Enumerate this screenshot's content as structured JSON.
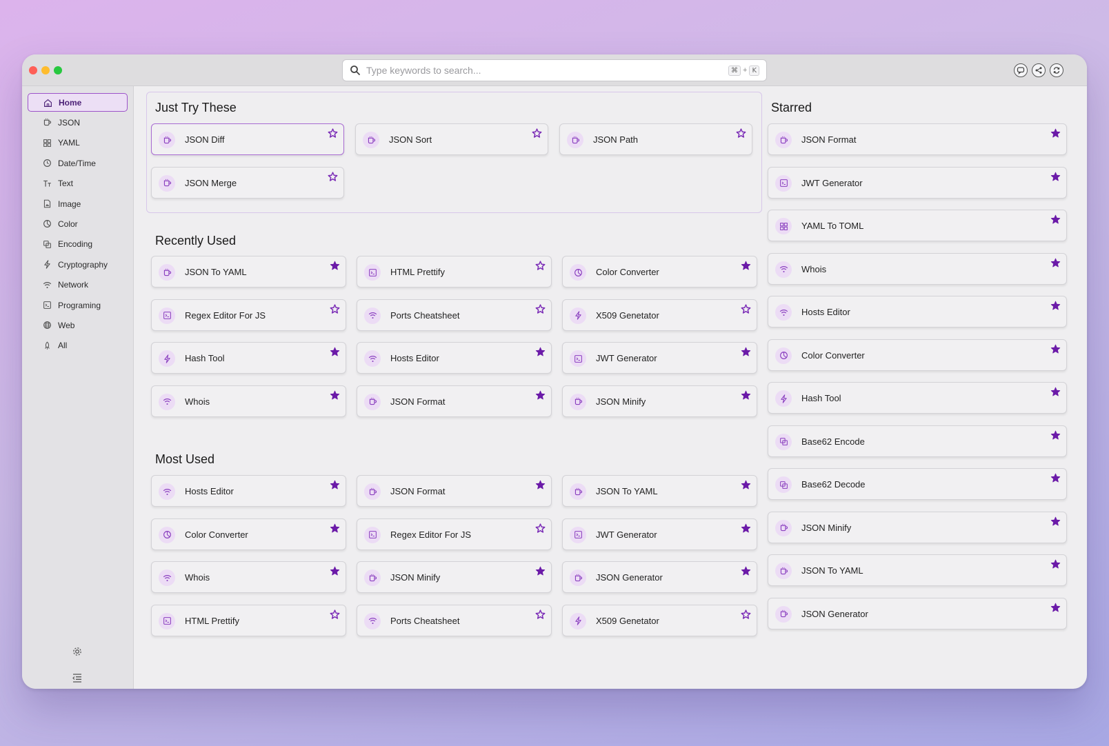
{
  "search": {
    "placeholder": "Type keywords to search...",
    "shortcut_cmd": "⌘",
    "shortcut_plus": "+",
    "shortcut_key": "K"
  },
  "sidebar": {
    "items": [
      {
        "label": "Home",
        "icon": "home-icon",
        "active": true
      },
      {
        "label": "JSON",
        "icon": "mug-icon"
      },
      {
        "label": "YAML",
        "icon": "grid-icon"
      },
      {
        "label": "Date/Time",
        "icon": "clock-icon"
      },
      {
        "label": "Text",
        "icon": "text-icon"
      },
      {
        "label": "Image",
        "icon": "image-icon"
      },
      {
        "label": "Color",
        "icon": "palette-icon"
      },
      {
        "label": "Encoding",
        "icon": "encoding-icon"
      },
      {
        "label": "Cryptography",
        "icon": "bolt-icon"
      },
      {
        "label": "Network",
        "icon": "wifi-icon"
      },
      {
        "label": "Programing",
        "icon": "terminal-icon"
      },
      {
        "label": "Web",
        "icon": "globe-icon"
      },
      {
        "label": "All",
        "icon": "rocket-icon"
      }
    ]
  },
  "sections": {
    "just_try": {
      "title": "Just Try These",
      "cards": [
        {
          "label": "JSON Diff",
          "icon": "mug-icon",
          "starred": false,
          "highlight": true
        },
        {
          "label": "JSON Sort",
          "icon": "mug-icon",
          "starred": false
        },
        {
          "label": "JSON Path",
          "icon": "mug-icon",
          "starred": false
        },
        {
          "label": "JSON Merge",
          "icon": "mug-icon",
          "starred": false
        }
      ]
    },
    "recently_used": {
      "title": "Recently Used",
      "cards": [
        {
          "label": "JSON To YAML",
          "icon": "mug-icon",
          "starred": true
        },
        {
          "label": "HTML Prettify",
          "icon": "terminal-icon",
          "starred": false
        },
        {
          "label": "Color Converter",
          "icon": "palette-icon",
          "starred": true
        },
        {
          "label": "Regex Editor For JS",
          "icon": "terminal-icon",
          "starred": false
        },
        {
          "label": "Ports Cheatsheet",
          "icon": "wifi-icon",
          "starred": false
        },
        {
          "label": "X509 Genetator",
          "icon": "bolt-icon",
          "starred": false
        },
        {
          "label": "Hash Tool",
          "icon": "bolt-icon",
          "starred": true
        },
        {
          "label": "Hosts Editor",
          "icon": "wifi-icon",
          "starred": true
        },
        {
          "label": "JWT Generator",
          "icon": "terminal-icon",
          "starred": true
        },
        {
          "label": "Whois",
          "icon": "wifi-icon",
          "starred": true
        },
        {
          "label": "JSON Format",
          "icon": "mug-icon",
          "starred": true
        },
        {
          "label": "JSON Minify",
          "icon": "mug-icon",
          "starred": true
        }
      ]
    },
    "most_used": {
      "title": "Most Used",
      "cards": [
        {
          "label": "Hosts Editor",
          "icon": "wifi-icon",
          "starred": true
        },
        {
          "label": "JSON Format",
          "icon": "mug-icon",
          "starred": true
        },
        {
          "label": "JSON To YAML",
          "icon": "mug-icon",
          "starred": true
        },
        {
          "label": "Color Converter",
          "icon": "palette-icon",
          "starred": true
        },
        {
          "label": "Regex Editor For JS",
          "icon": "terminal-icon",
          "starred": false
        },
        {
          "label": "JWT Generator",
          "icon": "terminal-icon",
          "starred": true
        },
        {
          "label": "Whois",
          "icon": "wifi-icon",
          "starred": true
        },
        {
          "label": "JSON Minify",
          "icon": "mug-icon",
          "starred": true
        },
        {
          "label": "JSON Generator",
          "icon": "mug-icon",
          "starred": true
        },
        {
          "label": "HTML Prettify",
          "icon": "terminal-icon",
          "starred": false
        },
        {
          "label": "Ports Cheatsheet",
          "icon": "wifi-icon",
          "starred": false
        },
        {
          "label": "X509 Genetator",
          "icon": "bolt-icon",
          "starred": false
        }
      ]
    },
    "starred": {
      "title": "Starred",
      "cards": [
        {
          "label": "JSON Format",
          "icon": "mug-icon",
          "starred": true
        },
        {
          "label": "JWT Generator",
          "icon": "terminal-icon",
          "starred": true
        },
        {
          "label": "YAML To TOML",
          "icon": "grid-icon",
          "starred": true
        },
        {
          "label": "Whois",
          "icon": "wifi-icon",
          "starred": true
        },
        {
          "label": "Hosts Editor",
          "icon": "wifi-icon",
          "starred": true
        },
        {
          "label": "Color Converter",
          "icon": "palette-icon",
          "starred": true
        },
        {
          "label": "Hash Tool",
          "icon": "bolt-icon",
          "starred": true
        },
        {
          "label": "Base62 Encode",
          "icon": "encoding-icon",
          "starred": true
        },
        {
          "label": "Base62 Decode",
          "icon": "encoding-icon",
          "starred": true
        },
        {
          "label": "JSON Minify",
          "icon": "mug-icon",
          "starred": true
        },
        {
          "label": "JSON To YAML",
          "icon": "mug-icon",
          "starred": true
        },
        {
          "label": "JSON Generator",
          "icon": "mug-icon",
          "starred": true
        }
      ]
    }
  },
  "colors": {
    "accent": "#6b1aa8",
    "accent_light": "#ecdcf5",
    "active_border": "#9c52c9"
  }
}
